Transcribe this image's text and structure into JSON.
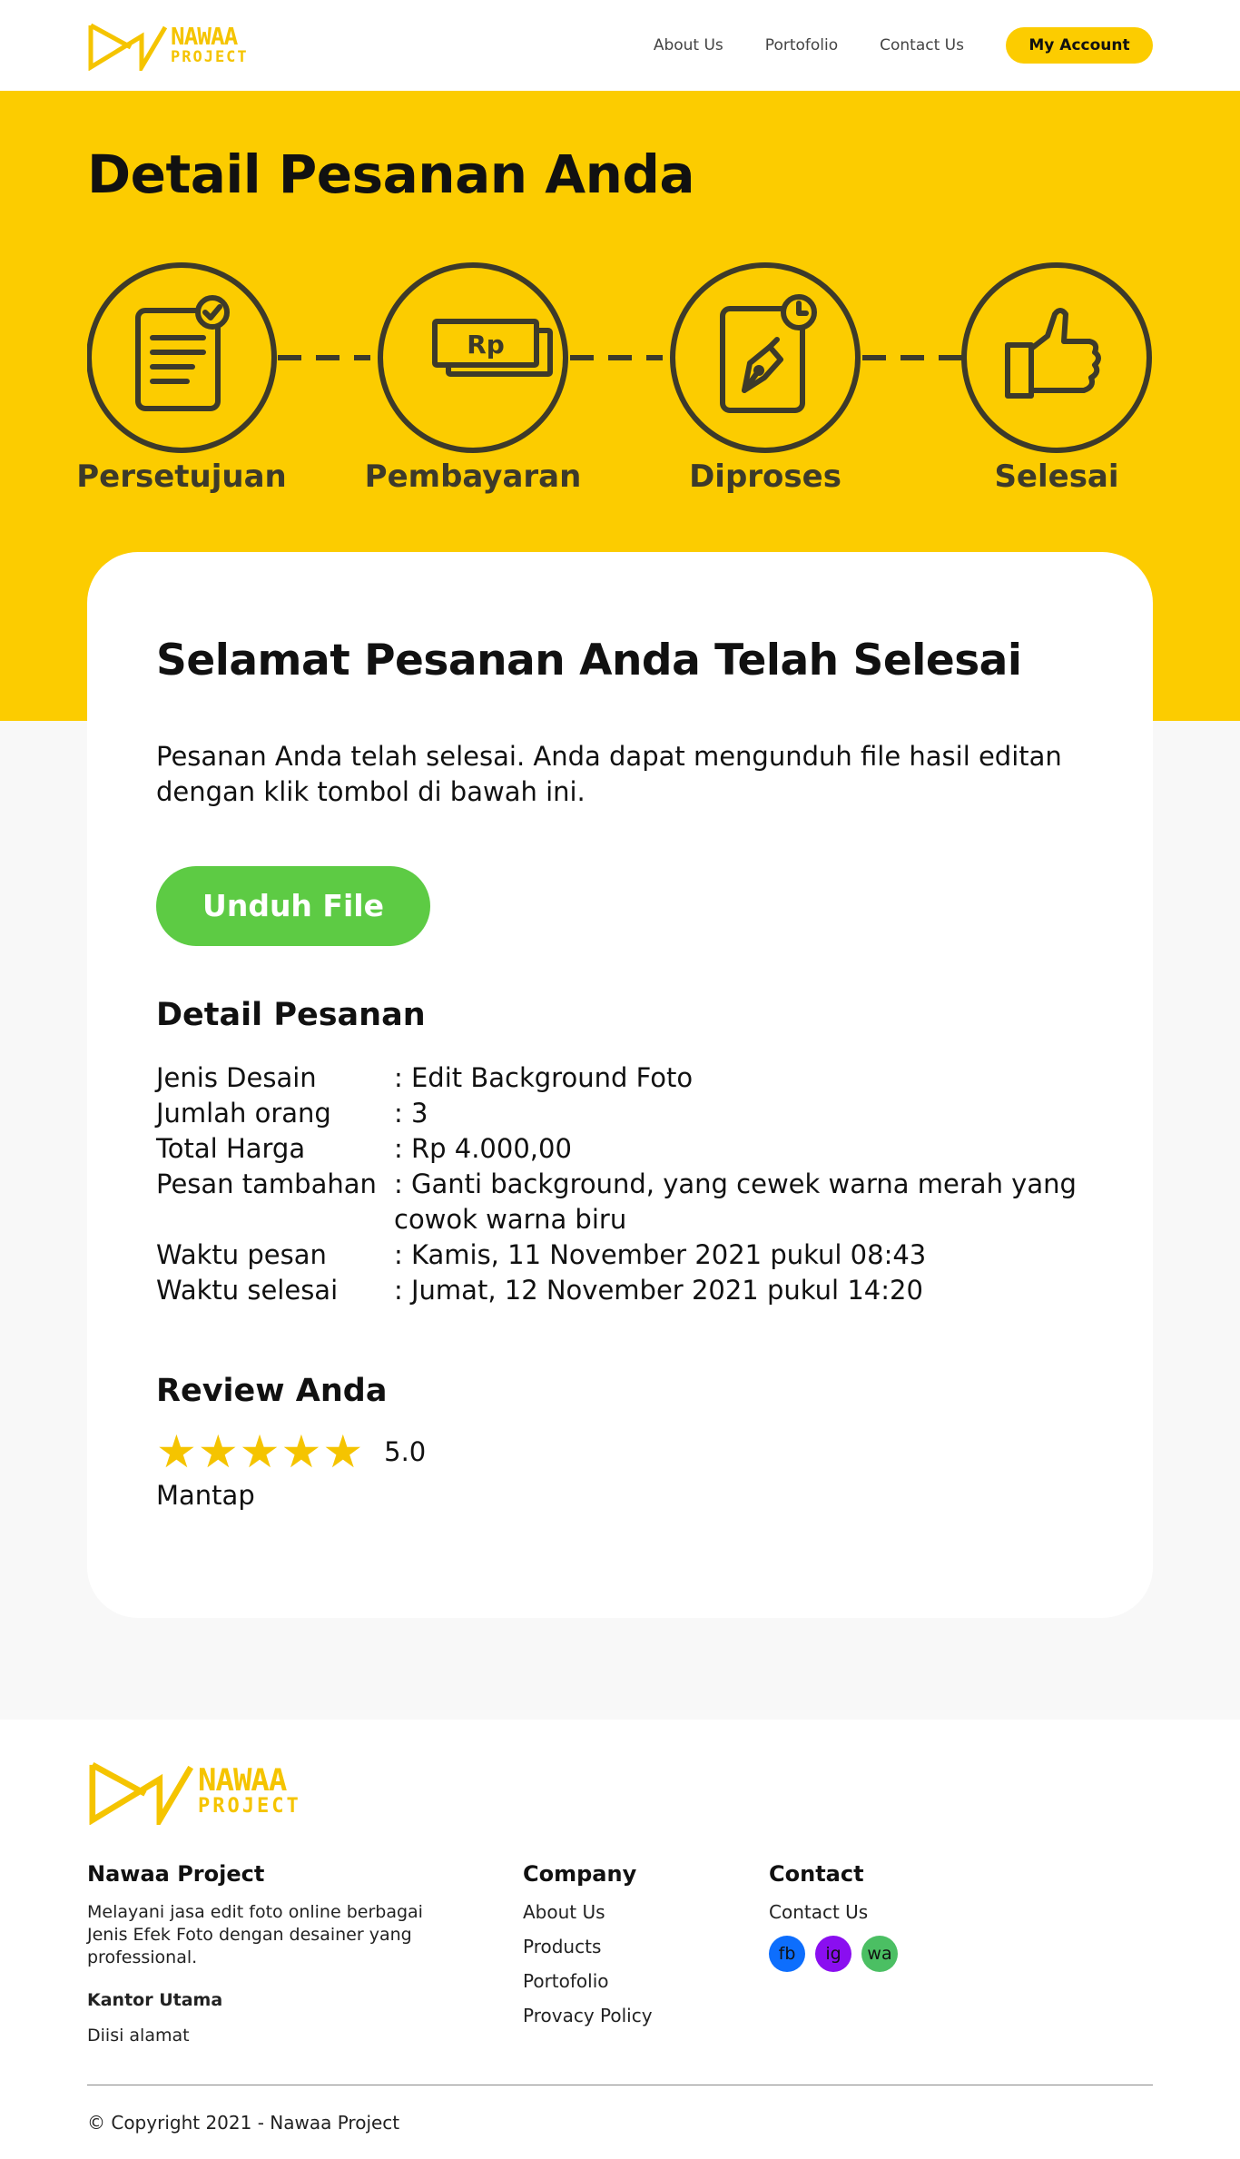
{
  "header": {
    "logo_line1": "NAWAA",
    "logo_line2": "PROJECT",
    "nav": [
      "About Us",
      "Portofolio",
      "Contact Us"
    ],
    "account_label": "My Account"
  },
  "hero": {
    "title": "Detail Pesanan Anda",
    "steps": [
      {
        "label": "Persetujuan",
        "icon": "document-check-icon"
      },
      {
        "label": "Pembayaran",
        "icon": "money-rp-icon",
        "icon_text": "Rp"
      },
      {
        "label": "Diproses",
        "icon": "pen-clock-icon"
      },
      {
        "label": "Selesai",
        "icon": "thumbs-up-icon"
      }
    ]
  },
  "card": {
    "title": "Selamat Pesanan Anda Telah Selesai",
    "description": "Pesanan Anda telah selesai. Anda dapat mengunduh file hasil editan dengan klik tombol di bawah ini.",
    "download_label": "Unduh File",
    "detail_heading": "Detail Pesanan",
    "details": [
      {
        "key": "Jenis Desain",
        "value": ": Edit Background Foto"
      },
      {
        "key": "Jumlah orang",
        "value": ": 3"
      },
      {
        "key": "Total Harga",
        "value": ": Rp 4.000,00"
      },
      {
        "key": "Pesan tambahan",
        "value": ": Ganti background, yang cewek warna merah yang cowok warna biru"
      },
      {
        "key": "Waktu pesan",
        "value": ": Kamis, 11 November 2021 pukul 08:43"
      },
      {
        "key": "Waktu selesai",
        "value": ": Jumat, 12 November 2021 pukul 14:20"
      }
    ],
    "review_heading": "Review Anda",
    "rating_stars": 5,
    "rating_value": "5.0",
    "review_text": "Mantap"
  },
  "footer": {
    "logo_line1": "NAWAA",
    "logo_line2": "PROJECT",
    "about_title": "Nawaa Project",
    "about_text": "Melayani jasa edit foto online berbagai Jenis Efek Foto dengan desainer yang professional.",
    "office_label": "Kantor Utama",
    "office_address": "Diisi alamat",
    "company_title": "Company",
    "company_links": [
      "About Us",
      "Products",
      "Portofolio",
      "Provacy Policy"
    ],
    "contact_title": "Contact",
    "contact_link": "Contact Us",
    "socials": [
      {
        "label": "fb",
        "color": "#0d6efd"
      },
      {
        "label": "ig",
        "color": "#8a0ef0"
      },
      {
        "label": "wa",
        "color": "#4bbf63"
      }
    ],
    "copyright": "© Copyright 2021 - Nawaa Project"
  },
  "colors": {
    "accent_yellow": "#fccc00",
    "success_green": "#5dcb44",
    "icon_dark": "#3d3a2a"
  }
}
